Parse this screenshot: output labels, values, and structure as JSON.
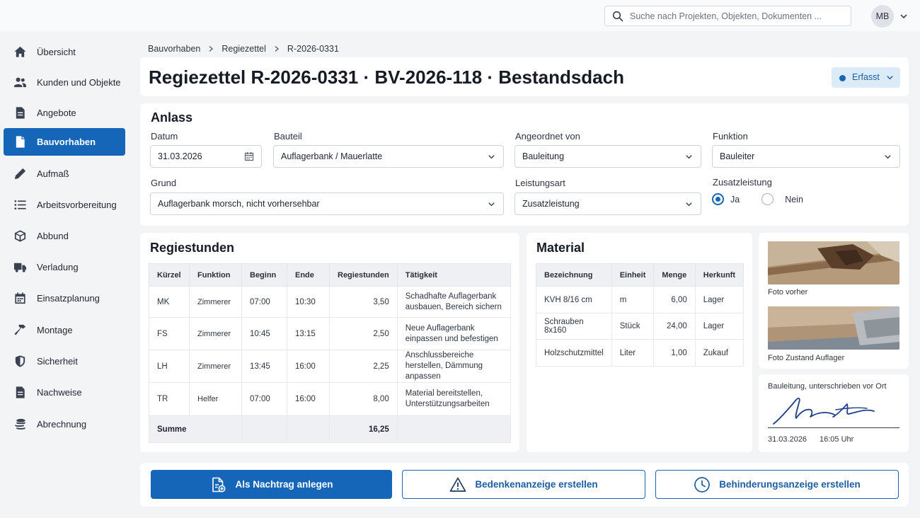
{
  "topbar": {
    "search_placeholder": "Suche nach Projekten, Objekten, Dokumenten ...",
    "user_initials": "MB"
  },
  "sidebar": {
    "items": [
      {
        "label": "Übersicht",
        "icon": "home-icon"
      },
      {
        "label": "Kunden und Objekte",
        "icon": "users-icon"
      },
      {
        "label": "Angebote",
        "icon": "document-icon"
      },
      {
        "label": "Bauvorhaben",
        "icon": "file-icon",
        "active": true
      },
      {
        "label": "Aufmaß",
        "icon": "pencil-icon"
      },
      {
        "label": "Arbeitsvorbereitung",
        "icon": "list-icon"
      },
      {
        "label": "Abbund",
        "icon": "cube-icon"
      },
      {
        "label": "Verladung",
        "icon": "truck-icon"
      },
      {
        "label": "Einsatzplanung",
        "icon": "calendar-icon"
      },
      {
        "label": "Montage",
        "icon": "hammer-icon"
      },
      {
        "label": "Sicherheit",
        "icon": "shield-icon"
      },
      {
        "label": "Nachweise",
        "icon": "document-icon"
      },
      {
        "label": "Abrechnung",
        "icon": "coins-icon"
      }
    ]
  },
  "breadcrumb": [
    "Bauvorhaben",
    "Regiezettel",
    "R-2026-0331"
  ],
  "header": {
    "title": "Regiezettel R-2026-0331 · BV-2026-118 · Bestandsdach",
    "status": "Erfasst"
  },
  "anlass": {
    "title": "Anlass",
    "datum_label": "Datum",
    "datum_value": "31.03.2026",
    "bauteil_label": "Bauteil",
    "bauteil_value": "Auflagerbank / Mauerlatte",
    "angeordnet_label": "Angeordnet von",
    "angeordnet_value": "Bauleitung",
    "funktion_label": "Funktion",
    "funktion_value": "Bauleiter",
    "grund_label": "Grund",
    "grund_value": "Auflagerbank morsch, nicht vorhersehbar",
    "leistungsart_label": "Leistungsart",
    "leistungsart_value": "Zusatzleistung",
    "zusatz_label": "Zusatzleistung",
    "zusatz_ja": "Ja",
    "zusatz_nein": "Nein"
  },
  "regiestunden": {
    "title": "Regiestunden",
    "columns": [
      "Kürzel",
      "Funktion",
      "Beginn",
      "Ende",
      "Regiestunden",
      "Tätigkeit"
    ],
    "rows": [
      [
        "MK",
        "Zimmerer",
        "07:00",
        "10:30",
        "3,50",
        "Schadhafte Auflagerbank ausbauen, Bereich sichern"
      ],
      [
        "FS",
        "Zimmerer",
        "10:45",
        "13:15",
        "2,50",
        "Neue Auflagerbank einpassen und befestigen"
      ],
      [
        "LH",
        "Zimmerer",
        "13:45",
        "16:00",
        "2,25",
        "Anschlussbereiche herstellen, Dämmung anpassen"
      ],
      [
        "TR",
        "Helfer",
        "07:00",
        "16:00",
        "8,00",
        "Material bereitstellen, Unterstützungsarbeiten"
      ]
    ],
    "sum_label": "Summe",
    "sum_value": "16,25"
  },
  "material": {
    "title": "Material",
    "columns": [
      "Bezeichnung",
      "Einheit",
      "Menge",
      "Herkunft"
    ],
    "rows": [
      [
        "KVH 8/16 cm",
        "m",
        "6,00",
        "Lager"
      ],
      [
        "Schrauben 8x160",
        "Stück",
        "24,00",
        "Lager"
      ],
      [
        "Holzschutzmittel",
        "Liter",
        "1,00",
        "Zukauf"
      ]
    ]
  },
  "photos": {
    "before_caption": "Foto vorher",
    "support_caption": "Foto Zustand Auflager"
  },
  "signature": {
    "title": "Bauleitung, unterschrieben vor Ort",
    "date": "31.03.2026",
    "time": "16:05 Uhr"
  },
  "actions": {
    "nachtrag": "Als Nachtrag anlegen",
    "bedenken": "Bedenkenanzeige erstellen",
    "behinderung": "Behinderungsanzeige erstellen"
  },
  "colors": {
    "accent": "#1565b8",
    "status_bg": "#dcebf8",
    "background": "#f3f4f6"
  }
}
